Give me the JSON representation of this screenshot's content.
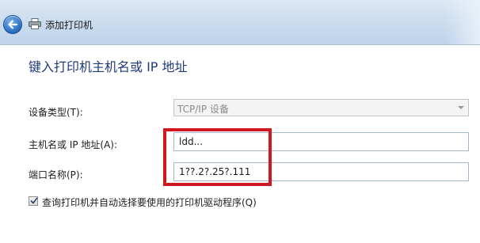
{
  "window": {
    "title": "添加打印机"
  },
  "main": {
    "heading": "键入打印机主机名或 IP 地址",
    "device_type": {
      "label": "设备类型(T):",
      "value": "TCP/IP 设备"
    },
    "hostname": {
      "label": "主机名或 IP 地址(A):",
      "value": "ldd..."
    },
    "port_name": {
      "label": "端口名称(P):",
      "value": "1??.2?.25?.111"
    },
    "query_checkbox": {
      "label": "查询打印机并自动选择要使用的打印机驱动程序(Q)",
      "checked": true
    }
  },
  "icons": {
    "back": "back-arrow-icon",
    "printer": "printer-icon",
    "dropdown": "chevron-down-icon",
    "check": "check-icon"
  },
  "colors": {
    "heading": "#1e3b78",
    "highlight": "#d01820",
    "titlebar": "#c9dbee"
  }
}
